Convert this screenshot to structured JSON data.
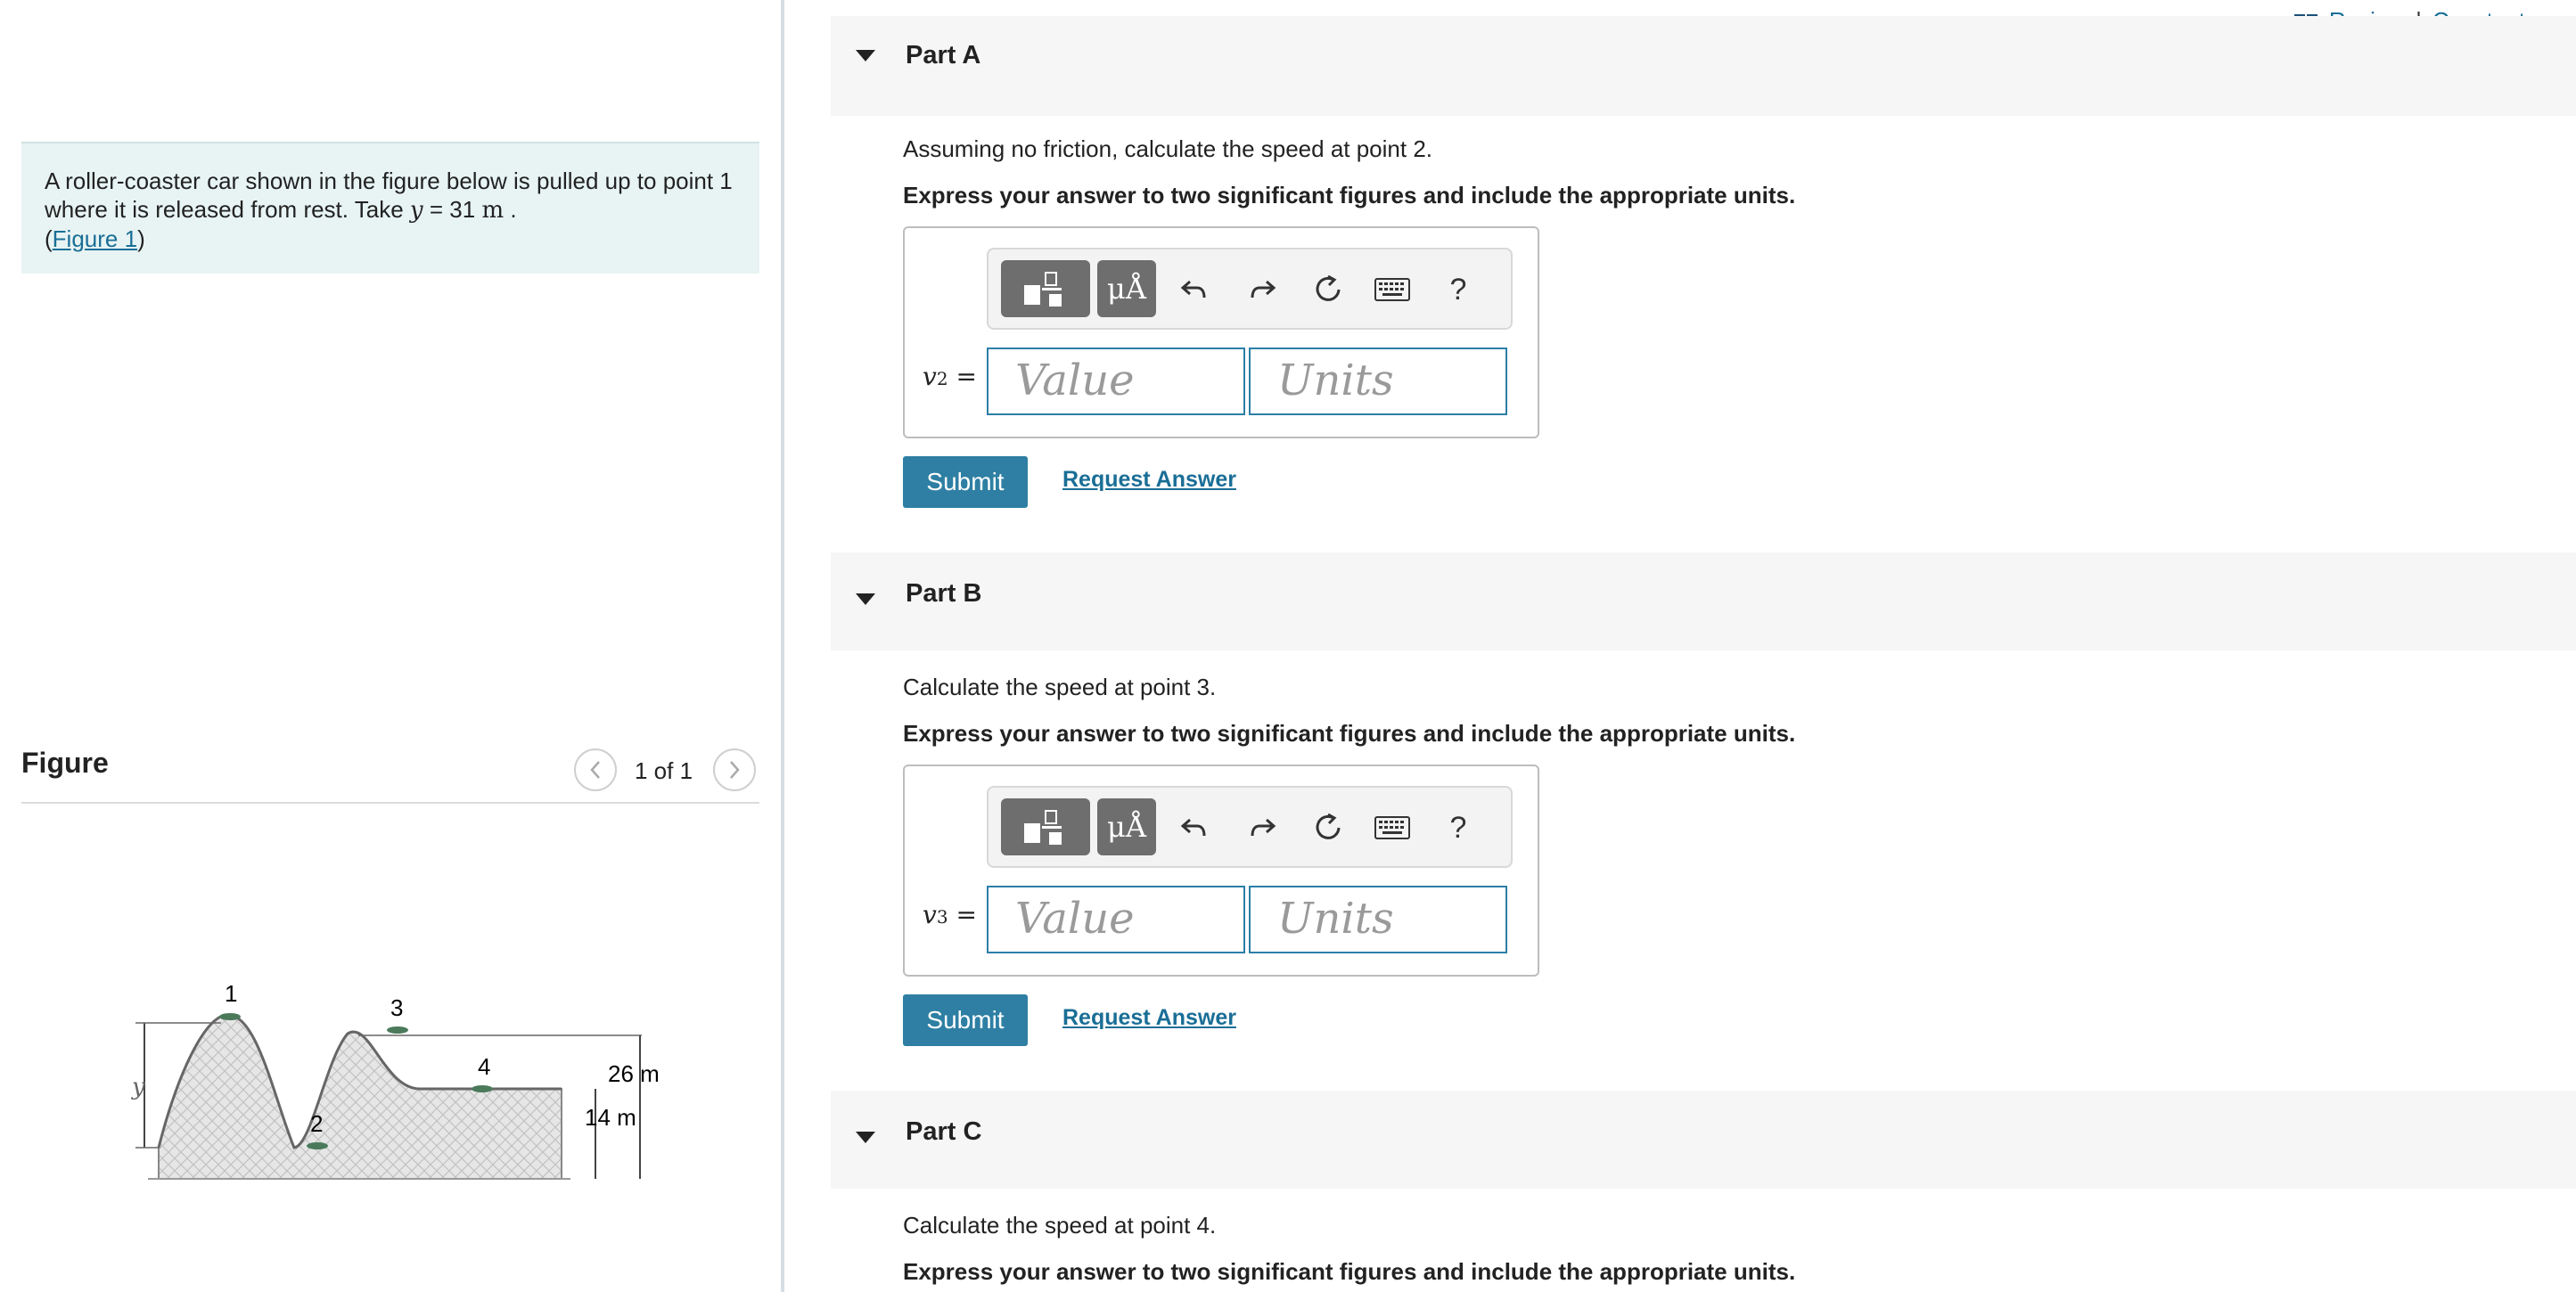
{
  "top_links": {
    "review": "Review",
    "separator": "|",
    "constants": "Constants"
  },
  "problem": {
    "text_1": "A roller-coaster car shown in the figure below is pulled up to point 1",
    "text_2": "where it is released from rest. Take",
    "var_y": "y",
    "eq": "=",
    "y_value": "31",
    "y_unit": "m",
    "period": ".",
    "figure_link": "Figure 1",
    "paren_open": "(",
    "paren_close": ")"
  },
  "figure": {
    "title": "Figure",
    "pager": "1 of 1",
    "prev_icon": "chevron-left-icon",
    "next_icon": "chevron-right-icon",
    "labels": {
      "p1": "1",
      "p2": "2",
      "p3": "3",
      "p4": "4",
      "y": "y",
      "h26": "26 m",
      "h14": "14 m"
    }
  },
  "parts": [
    {
      "label": "Part A",
      "question": "Assuming no friction, calculate the speed at point 2.",
      "instruction": "Express your answer to two significant figures and include the appropriate units.",
      "var": "v",
      "sub": "2",
      "value_placeholder": "Value",
      "units_placeholder": "Units",
      "submit": "Submit",
      "request": "Request Answer"
    },
    {
      "label": "Part B",
      "question": "Calculate the speed at point 3.",
      "instruction": "Express your answer to two significant figures and include the appropriate units.",
      "var": "v",
      "sub": "3",
      "value_placeholder": "Value",
      "units_placeholder": "Units",
      "submit": "Submit",
      "request": "Request Answer"
    },
    {
      "label": "Part C",
      "question": "Calculate the speed at point 4.",
      "instruction": "Express your answer to two significant figures and include the appropriate units."
    }
  ],
  "toolbar": {
    "units_glyph": "μÅ",
    "help": "?",
    "icons": [
      "templates-icon",
      "units-icon",
      "undo-icon",
      "redo-icon",
      "reset-icon",
      "keyboard-icon",
      "help-icon"
    ]
  },
  "colors": {
    "accent": "#2e7fa3",
    "link": "#1a6e96",
    "problem_bg": "#e8f4f4",
    "part_header_bg": "#f6f6f6"
  }
}
